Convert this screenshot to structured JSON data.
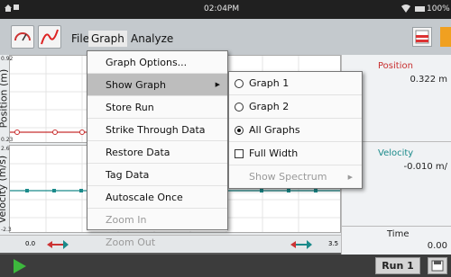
{
  "statusbar": {
    "time": "02:04PM",
    "battery": "100%"
  },
  "toolbar": {
    "menus": [
      "File",
      "Graph",
      "Analyze"
    ],
    "active_menu": "Graph"
  },
  "graphs": [
    {
      "axis_title": "Position (m)",
      "y_max": "0.92",
      "y_min": "0.23",
      "color": "#c83030"
    },
    {
      "axis_title": "Velocity (m/s)",
      "y_max": "2.6",
      "y_min": "-2.3",
      "color": "#1a8a8a"
    }
  ],
  "x_axis": {
    "min": "0.0",
    "max": "3.5"
  },
  "meters": [
    {
      "title": "Position",
      "value": "0.322 m"
    },
    {
      "title": "Velocity",
      "value": "-0.010 m/"
    },
    {
      "title": "Time",
      "value": "0.00"
    }
  ],
  "graph_menu": [
    {
      "label": "Graph Options...",
      "state": "normal"
    },
    {
      "label": "Show Graph",
      "state": "highlighted",
      "submenu": true
    },
    {
      "label": "Store Run",
      "state": "normal"
    },
    {
      "label": "Strike Through Data",
      "state": "normal"
    },
    {
      "label": "Restore Data",
      "state": "normal"
    },
    {
      "label": "Tag Data",
      "state": "normal"
    },
    {
      "label": "Autoscale Once",
      "state": "normal"
    },
    {
      "label": "Zoom In",
      "state": "disabled"
    },
    {
      "label": "Zoom Out",
      "state": "disabled"
    }
  ],
  "show_graph_submenu": [
    {
      "label": "Graph 1",
      "kind": "radio",
      "selected": false
    },
    {
      "label": "Graph 2",
      "kind": "radio",
      "selected": false
    },
    {
      "label": "All Graphs",
      "kind": "radio",
      "selected": true
    },
    {
      "label": "Full Width",
      "kind": "checkbox",
      "checked": false
    },
    {
      "label": "Show Spectrum",
      "kind": "submenu",
      "disabled": true
    }
  ],
  "footer": {
    "run_label": "Run 1"
  }
}
